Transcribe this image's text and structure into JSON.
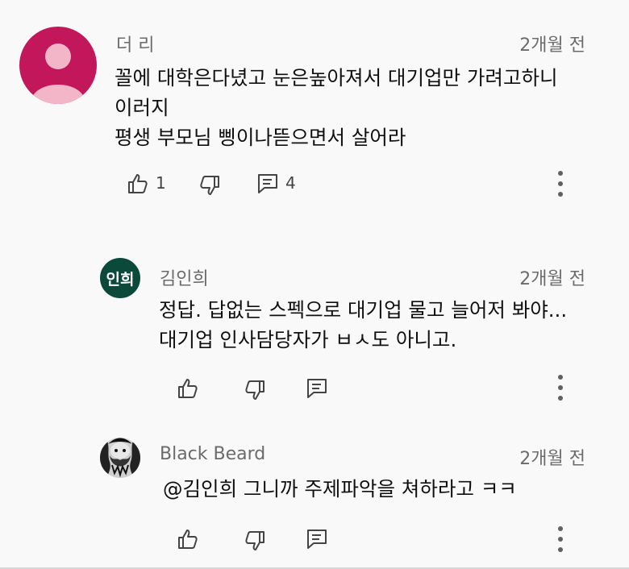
{
  "comments": [
    {
      "author": "더 리",
      "time": "2개월 전",
      "lines": [
        "꼴에 대학은다녔고 눈은높아져서 대기업만 가려고하니",
        "이러지",
        "평생 부모님 삥이나뜯으면서 살어라"
      ],
      "likes": "1",
      "replies": "4",
      "avatar_color": "#c2185b",
      "icons": [
        "thumb-up-icon",
        "thumb-down-icon",
        "comment-icon",
        "more-vert-icon"
      ]
    },
    {
      "author": "김인희",
      "time": "2개월 전",
      "avatar_text": "인희",
      "avatar_color": "#0b4a3a",
      "lines": [
        "정답. 답없는 스펙으로 대기업 물고 늘어저 봐야...",
        "대기업 인사담당자가 ㅂㅅ도 아니고."
      ],
      "icons": [
        "thumb-up-icon",
        "thumb-down-icon",
        "reply-icon",
        "more-vert-icon"
      ]
    },
    {
      "author": "Black Beard",
      "time": "2개월 전",
      "lines": [
        "@김인희  그니까 주제파악을 쳐하라고 ㅋㅋ"
      ],
      "icons": [
        "thumb-up-icon",
        "thumb-down-icon",
        "reply-icon",
        "more-vert-icon"
      ]
    }
  ]
}
